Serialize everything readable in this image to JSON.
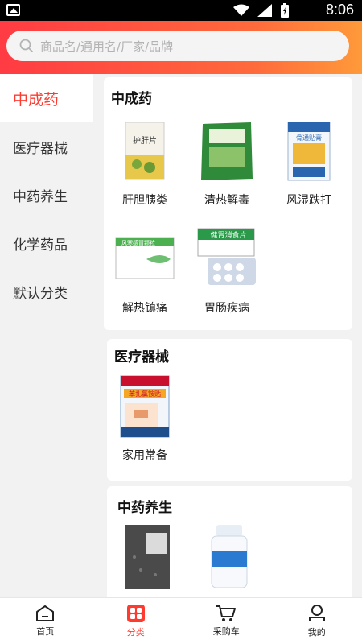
{
  "status_bar": {
    "time": "8:06"
  },
  "search": {
    "placeholder": "商品名/通用名/厂家/品牌"
  },
  "sidebar": {
    "items": [
      {
        "label": "中成药",
        "active": true
      },
      {
        "label": "医疗器械",
        "active": false
      },
      {
        "label": "中药养生",
        "active": false
      },
      {
        "label": "化学药品",
        "active": false
      },
      {
        "label": "默认分类",
        "active": false
      }
    ]
  },
  "sections": [
    {
      "title": "中成药",
      "products": [
        {
          "label": "肝胆胰类",
          "pkg_text": "护肝片"
        },
        {
          "label": "清热解毒",
          "pkg_text": ""
        },
        {
          "label": "风湿跌打",
          "pkg_text": "骨通贴膏"
        },
        {
          "label": "解热镇痛",
          "pkg_text": "风寒感冒颗粒"
        },
        {
          "label": "胃肠疾病",
          "pkg_text": "健胃消食片"
        }
      ]
    },
    {
      "title": "医疗器械",
      "products": [
        {
          "label": "家用常备",
          "pkg_text": "苯扎氯铵贴"
        }
      ]
    },
    {
      "title": "中药养生",
      "products": [
        {
          "label": "",
          "pkg_text": ""
        },
        {
          "label": "",
          "pkg_text": ""
        }
      ]
    }
  ],
  "navbar": {
    "items": [
      {
        "label": "首页",
        "icon": "home-icon",
        "active": false
      },
      {
        "label": "分类",
        "icon": "category-icon",
        "active": true
      },
      {
        "label": "采购车",
        "icon": "cart-icon",
        "active": false
      },
      {
        "label": "我的",
        "icon": "profile-icon",
        "active": false
      }
    ]
  },
  "colors": {
    "accent": "#ff3b30",
    "header_start": "#ff3b43",
    "header_end": "#ff9a3a"
  }
}
